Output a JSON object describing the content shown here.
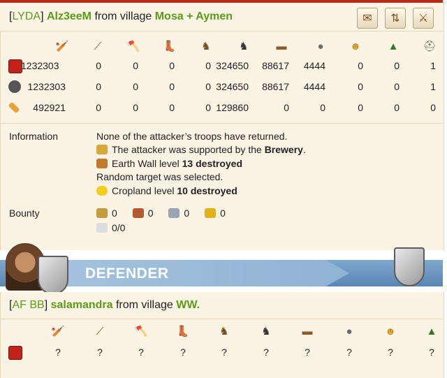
{
  "attacker": {
    "title": {
      "bracket_open": "[",
      "alliance": "LYDA",
      "bracket_close": "]",
      "player": "Alz3eeM",
      "from_village_text": "from village",
      "village": "Mosa + Aymen"
    },
    "action_icons": [
      "scroll-icon",
      "report-icon",
      "swords-icon"
    ],
    "unit_icons": [
      "club-icon",
      "spear-icon",
      "axe-icon",
      "boot-icon",
      "horse-icon",
      "dark-horse-icon",
      "ram-icon",
      "catapult-icon",
      "chief-icon",
      "settler-icon",
      "hero-icon"
    ],
    "rows": [
      {
        "icon": "troops-icon",
        "values": [
          "1232303",
          "0",
          "0",
          "0",
          "0",
          "324650",
          "88617",
          "4444",
          "0",
          "0",
          "1"
        ]
      },
      {
        "icon": "casualties-skull-icon",
        "values": [
          "1232303",
          "0",
          "0",
          "0",
          "0",
          "324650",
          "88617",
          "4444",
          "0",
          "0",
          "1"
        ]
      },
      {
        "icon": "injured-bandage-icon",
        "values": [
          "492921",
          "0",
          "0",
          "0",
          "0",
          "129860",
          "0",
          "0",
          "0",
          "0",
          "0"
        ]
      }
    ],
    "information_label": "Information",
    "info": {
      "line1": "None of the attacker’s troops have returned.",
      "line2_prefix": "The attacker was supported by the",
      "line2_bold": "Brewery",
      "line2_suffix": ".",
      "line3_prefix": "Earth Wall level",
      "line3_bold": "13 destroyed",
      "line4": "Random target was selected.",
      "line5_prefix": "Cropland level",
      "line5_bold": "10 destroyed"
    },
    "bounty_label": "Bounty",
    "bounty": {
      "wood": "0",
      "clay": "0",
      "iron": "0",
      "crop": "0",
      "carry": "0/0"
    }
  },
  "defender": {
    "banner": "DEFENDER",
    "title": {
      "bracket_open": "[",
      "alliance": "AF BB",
      "bracket_close": "]",
      "player": "salamandra",
      "from_village_text": "from village",
      "village": "WW."
    },
    "unit_icons": [
      "club-icon",
      "spear-icon",
      "axe-icon",
      "boot-icon",
      "horse-icon",
      "dark-horse-icon",
      "ram-icon",
      "catapult-icon",
      "chief-icon",
      "settler-icon"
    ],
    "row": {
      "icon": "troops-icon",
      "values": [
        "?",
        "?",
        "?",
        "?",
        "?",
        "?",
        "?",
        "?",
        "?",
        "?"
      ]
    }
  }
}
